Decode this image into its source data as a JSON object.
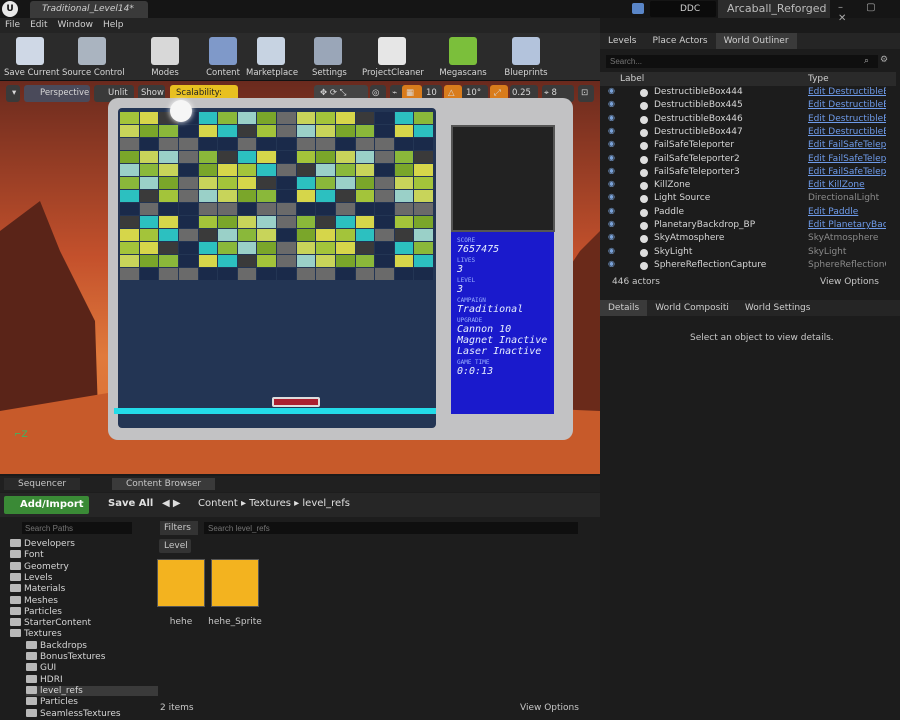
{
  "window": {
    "tab_title": "Traditional_Level14*",
    "ddc_label": "DDC",
    "project_name": "Arcaball_Reforged",
    "controls": "– ▢ ✕"
  },
  "menu": [
    "File",
    "Edit",
    "Window",
    "Help"
  ],
  "toolbar": [
    {
      "label": "Save Current",
      "icon": "save-icon",
      "color": "#cfd8e6"
    },
    {
      "label": "Source Control",
      "icon": "source-control-icon",
      "color": "#aab4c0"
    },
    {
      "label": "Modes",
      "icon": "modes-icon",
      "color": "#d8d8d8"
    },
    {
      "label": "Content",
      "icon": "content-icon",
      "color": "#7f99c9"
    },
    {
      "label": "Marketplace",
      "icon": "marketplace-icon",
      "color": "#c7d3e2"
    },
    {
      "label": "Settings",
      "icon": "settings-icon",
      "color": "#9aa6b8"
    },
    {
      "label": "ProjectCleaner",
      "icon": "trash-icon",
      "color": "#e6e6e6"
    },
    {
      "label": "Megascans",
      "icon": "megascans-icon",
      "color": "#7bbf3b"
    },
    {
      "label": "Blueprints",
      "icon": "blueprints-icon",
      "color": "#b3c3dc"
    }
  ],
  "viewport": {
    "perspective": "Perspective",
    "unlit": "Unlit",
    "show": "Show",
    "scalability": "Scalability: Low",
    "grid": "10",
    "angle": "10°",
    "scale": "0.25",
    "cam_speed": "8"
  },
  "hud": {
    "score_label": "SCORE",
    "score": "7657475",
    "lives_label": "LIVES",
    "lives": "3",
    "level_label": "LEVEL",
    "level": "3",
    "campaign_label": "CAMPAIGN",
    "campaign": "Traditional",
    "upgrade_label": "UPGRADE",
    "upgrade1": "Cannon 10",
    "upgrade2": "Magnet Inactive",
    "upgrade3": "Laser Inactive",
    "time_label": "GAME TIME",
    "time": "0:0:13"
  },
  "right_tabs": [
    "Levels",
    "Place Actors",
    "World Outliner"
  ],
  "outliner": {
    "search_placeholder": "Search...",
    "col_label": "Label",
    "col_type": "Type",
    "rows": [
      {
        "label": "DestructibleBox444",
        "type": "Edit DestructibleBo",
        "link": true
      },
      {
        "label": "DestructibleBox445",
        "type": "Edit DestructibleBo",
        "link": true
      },
      {
        "label": "DestructibleBox446",
        "type": "Edit DestructibleBo",
        "link": true
      },
      {
        "label": "DestructibleBox447",
        "type": "Edit DestructibleBo",
        "link": true
      },
      {
        "label": "FailSafeTeleporter",
        "type": "Edit FailSafeTelepo",
        "link": true
      },
      {
        "label": "FailSafeTeleporter2",
        "type": "Edit FailSafeTelepo",
        "link": true
      },
      {
        "label": "FailSafeTeleporter3",
        "type": "Edit FailSafeTelepo",
        "link": true
      },
      {
        "label": "KillZone",
        "type": "Edit KillZone",
        "link": true
      },
      {
        "label": "Light Source",
        "type": "DirectionalLight",
        "link": false
      },
      {
        "label": "Paddle",
        "type": "Edit Paddle",
        "link": true
      },
      {
        "label": "PlanetaryBackdrop_BP",
        "type": "Edit PlanetaryBack",
        "link": true
      },
      {
        "label": "SkyAtmosphere",
        "type": "SkyAtmosphere",
        "link": false
      },
      {
        "label": "SkyLight",
        "type": "SkyLight",
        "link": false
      },
      {
        "label": "SphereReflectionCapture",
        "type": "SphereReflectionCa",
        "link": false
      }
    ],
    "count": "446 actors",
    "view_options": "View Options"
  },
  "details": {
    "tabs": [
      "Details",
      "World Compositi",
      "World Settings"
    ],
    "empty_msg": "Select an object to view details."
  },
  "content": {
    "tabs": [
      "Sequencer",
      "Content Browser"
    ],
    "add_import": "Add/Import",
    "save_all": "Save All",
    "breadcrumb": [
      "Content",
      "Textures",
      "level_refs"
    ],
    "search_paths": "Search Paths",
    "filters": "Filters",
    "search_folder": "Search level_refs",
    "filter_chip": "Level",
    "tree": [
      {
        "label": "Developers",
        "depth": 1
      },
      {
        "label": "Font",
        "depth": 1
      },
      {
        "label": "Geometry",
        "depth": 1
      },
      {
        "label": "Levels",
        "depth": 1
      },
      {
        "label": "Materials",
        "depth": 1
      },
      {
        "label": "Meshes",
        "depth": 1
      },
      {
        "label": "Particles",
        "depth": 1
      },
      {
        "label": "StarterContent",
        "depth": 1
      },
      {
        "label": "Textures",
        "depth": 1
      },
      {
        "label": "Backdrops",
        "depth": 2
      },
      {
        "label": "BonusTextures",
        "depth": 2
      },
      {
        "label": "GUI",
        "depth": 2
      },
      {
        "label": "HDRI",
        "depth": 2
      },
      {
        "label": "level_refs",
        "depth": 2
      },
      {
        "label": "Particles",
        "depth": 2
      },
      {
        "label": "SeamlessTextures",
        "depth": 2
      }
    ],
    "assets": [
      "hehe",
      "hehe_Sprite"
    ],
    "count": "2 items",
    "view_options": "View Options"
  }
}
